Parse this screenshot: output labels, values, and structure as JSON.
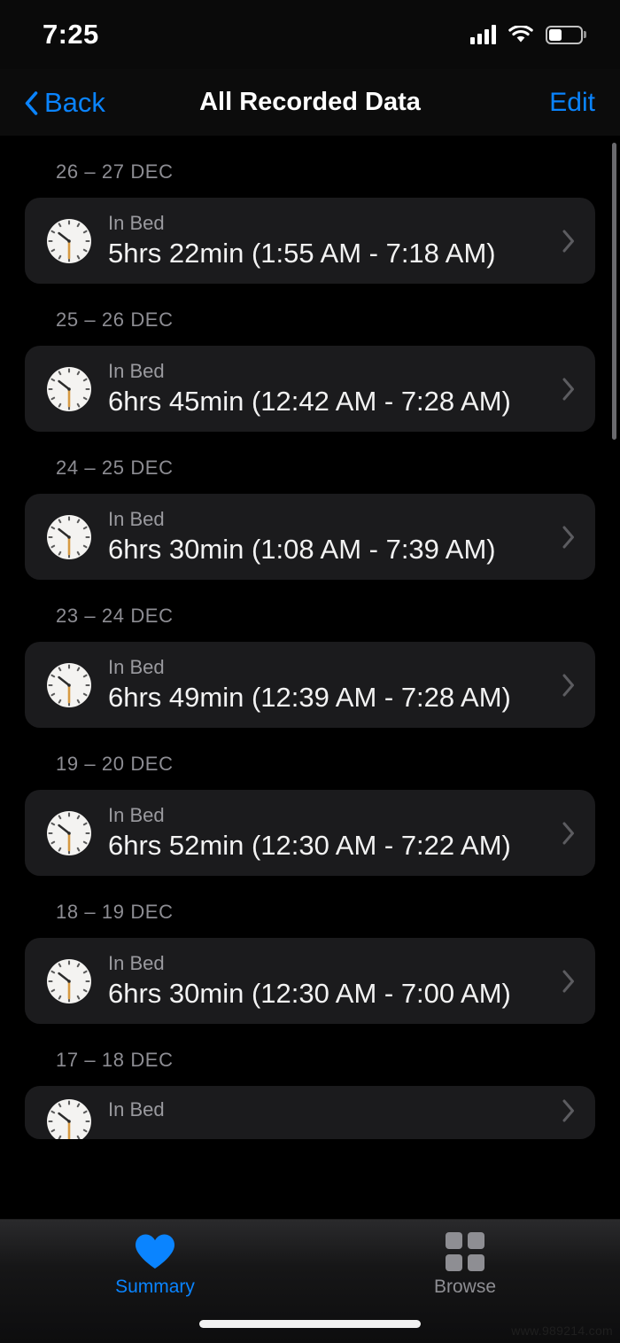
{
  "status_bar": {
    "time": "7:25",
    "signal_icon": "cellular-signal-icon",
    "wifi_icon": "wifi-icon",
    "battery_icon": "battery-icon",
    "battery_level_percent": 42
  },
  "nav_bar": {
    "back_label": "Back",
    "title": "All Recorded Data",
    "edit_label": "Edit",
    "accent_color": "#0a84ff"
  },
  "colors": {
    "background": "#000000",
    "card_background": "#1b1b1d",
    "accent": "#0a84ff",
    "secondary_text": "#8d8d93",
    "primary_text": "#f2f2f2"
  },
  "list": {
    "sections": [
      {
        "date_range": "26 – 27 DEC",
        "label": "In Bed",
        "value": "5hrs 22min (1:55 AM - 7:18 AM)",
        "duration_hours": 5,
        "duration_minutes": 22,
        "start_time": "1:55 AM",
        "end_time": "7:18 AM",
        "clipped": false
      },
      {
        "date_range": "25 – 26 DEC",
        "label": "In Bed",
        "value": "6hrs 45min (12:42 AM - 7:28 AM)",
        "duration_hours": 6,
        "duration_minutes": 45,
        "start_time": "12:42 AM",
        "end_time": "7:28 AM",
        "clipped": false
      },
      {
        "date_range": "24 – 25 DEC",
        "label": "In Bed",
        "value": "6hrs 30min (1:08 AM - 7:39 AM)",
        "duration_hours": 6,
        "duration_minutes": 30,
        "start_time": "1:08 AM",
        "end_time": "7:39 AM",
        "clipped": false
      },
      {
        "date_range": "23 – 24 DEC",
        "label": "In Bed",
        "value": "6hrs 49min (12:39 AM - 7:28 AM)",
        "duration_hours": 6,
        "duration_minutes": 49,
        "start_time": "12:39 AM",
        "end_time": "7:28 AM",
        "clipped": false
      },
      {
        "date_range": "19 – 20 DEC",
        "label": "In Bed",
        "value": "6hrs 52min (12:30 AM - 7:22 AM)",
        "duration_hours": 6,
        "duration_minutes": 52,
        "start_time": "12:30 AM",
        "end_time": "7:22 AM",
        "clipped": false
      },
      {
        "date_range": "18 – 19 DEC",
        "label": "In Bed",
        "value": "6hrs 30min (12:30 AM - 7:00 AM)",
        "duration_hours": 6,
        "duration_minutes": 30,
        "start_time": "12:30 AM",
        "end_time": "7:00 AM",
        "clipped": false
      },
      {
        "date_range": "17 – 18 DEC",
        "label": "In Bed",
        "value": "",
        "clipped": true
      }
    ],
    "row_icon": "clock-icon",
    "row_disclosure_icon": "chevron-right-icon"
  },
  "tab_bar": {
    "tabs": [
      {
        "label": "Summary",
        "icon": "heart-icon",
        "active": true
      },
      {
        "label": "Browse",
        "icon": "grid-icon",
        "active": false
      }
    ]
  },
  "watermark": {
    "text": "www.989214.com"
  }
}
